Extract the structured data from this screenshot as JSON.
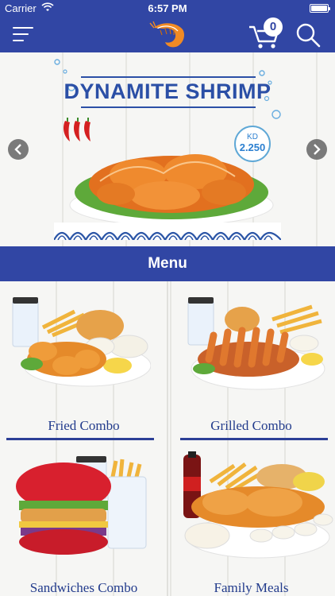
{
  "status_bar": {
    "carrier": "Carrier",
    "time": "6:57 PM"
  },
  "nav": {
    "cart_count": "0",
    "icons": [
      "menu-icon",
      "shrimp-logo",
      "cart-icon",
      "search-icon"
    ]
  },
  "banner": {
    "title": "DYNAMITE SHRIMP",
    "price_currency": "KD",
    "price_value": "2.250"
  },
  "menu_header": "Menu",
  "menu_items": [
    {
      "label": "Fried Combo"
    },
    {
      "label": "Grilled Combo"
    },
    {
      "label": "Sandwiches Combo"
    },
    {
      "label": "Family Meals"
    }
  ],
  "colors": {
    "primary": "#3146a4",
    "label_blue": "#223b8c"
  }
}
